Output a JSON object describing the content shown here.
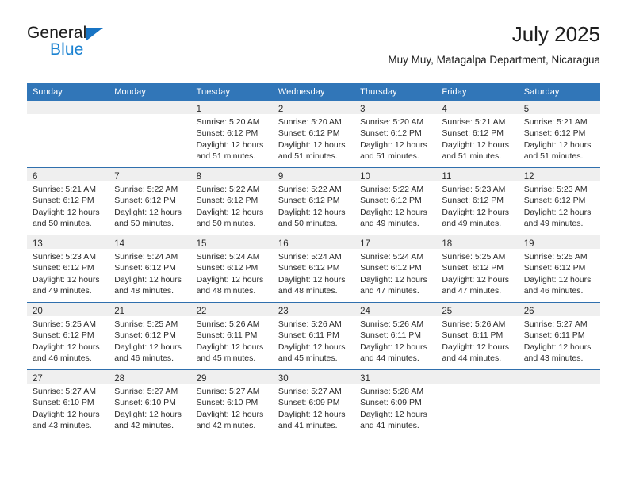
{
  "brand": {
    "name_top": "General",
    "name_bottom": "Blue",
    "triangle_icon": "brand-triangle-icon",
    "accent_color": "#1b82d1"
  },
  "header": {
    "title": "July 2025",
    "subtitle": "Muy Muy, Matagalpa Department, Nicaragua"
  },
  "theme": {
    "header_blue": "#3176b8",
    "row_separator": "#2f6fad",
    "daynum_band": "#efefef"
  },
  "weekday_headers": [
    "Sunday",
    "Monday",
    "Tuesday",
    "Wednesday",
    "Thursday",
    "Friday",
    "Saturday"
  ],
  "weeks": [
    [
      {
        "day": "",
        "lines": []
      },
      {
        "day": "",
        "lines": []
      },
      {
        "day": "1",
        "lines": [
          "Sunrise: 5:20 AM",
          "Sunset: 6:12 PM",
          "Daylight: 12 hours",
          "and 51 minutes."
        ]
      },
      {
        "day": "2",
        "lines": [
          "Sunrise: 5:20 AM",
          "Sunset: 6:12 PM",
          "Daylight: 12 hours",
          "and 51 minutes."
        ]
      },
      {
        "day": "3",
        "lines": [
          "Sunrise: 5:20 AM",
          "Sunset: 6:12 PM",
          "Daylight: 12 hours",
          "and 51 minutes."
        ]
      },
      {
        "day": "4",
        "lines": [
          "Sunrise: 5:21 AM",
          "Sunset: 6:12 PM",
          "Daylight: 12 hours",
          "and 51 minutes."
        ]
      },
      {
        "day": "5",
        "lines": [
          "Sunrise: 5:21 AM",
          "Sunset: 6:12 PM",
          "Daylight: 12 hours",
          "and 51 minutes."
        ]
      }
    ],
    [
      {
        "day": "6",
        "lines": [
          "Sunrise: 5:21 AM",
          "Sunset: 6:12 PM",
          "Daylight: 12 hours",
          "and 50 minutes."
        ]
      },
      {
        "day": "7",
        "lines": [
          "Sunrise: 5:22 AM",
          "Sunset: 6:12 PM",
          "Daylight: 12 hours",
          "and 50 minutes."
        ]
      },
      {
        "day": "8",
        "lines": [
          "Sunrise: 5:22 AM",
          "Sunset: 6:12 PM",
          "Daylight: 12 hours",
          "and 50 minutes."
        ]
      },
      {
        "day": "9",
        "lines": [
          "Sunrise: 5:22 AM",
          "Sunset: 6:12 PM",
          "Daylight: 12 hours",
          "and 50 minutes."
        ]
      },
      {
        "day": "10",
        "lines": [
          "Sunrise: 5:22 AM",
          "Sunset: 6:12 PM",
          "Daylight: 12 hours",
          "and 49 minutes."
        ]
      },
      {
        "day": "11",
        "lines": [
          "Sunrise: 5:23 AM",
          "Sunset: 6:12 PM",
          "Daylight: 12 hours",
          "and 49 minutes."
        ]
      },
      {
        "day": "12",
        "lines": [
          "Sunrise: 5:23 AM",
          "Sunset: 6:12 PM",
          "Daylight: 12 hours",
          "and 49 minutes."
        ]
      }
    ],
    [
      {
        "day": "13",
        "lines": [
          "Sunrise: 5:23 AM",
          "Sunset: 6:12 PM",
          "Daylight: 12 hours",
          "and 49 minutes."
        ]
      },
      {
        "day": "14",
        "lines": [
          "Sunrise: 5:24 AM",
          "Sunset: 6:12 PM",
          "Daylight: 12 hours",
          "and 48 minutes."
        ]
      },
      {
        "day": "15",
        "lines": [
          "Sunrise: 5:24 AM",
          "Sunset: 6:12 PM",
          "Daylight: 12 hours",
          "and 48 minutes."
        ]
      },
      {
        "day": "16",
        "lines": [
          "Sunrise: 5:24 AM",
          "Sunset: 6:12 PM",
          "Daylight: 12 hours",
          "and 48 minutes."
        ]
      },
      {
        "day": "17",
        "lines": [
          "Sunrise: 5:24 AM",
          "Sunset: 6:12 PM",
          "Daylight: 12 hours",
          "and 47 minutes."
        ]
      },
      {
        "day": "18",
        "lines": [
          "Sunrise: 5:25 AM",
          "Sunset: 6:12 PM",
          "Daylight: 12 hours",
          "and 47 minutes."
        ]
      },
      {
        "day": "19",
        "lines": [
          "Sunrise: 5:25 AM",
          "Sunset: 6:12 PM",
          "Daylight: 12 hours",
          "and 46 minutes."
        ]
      }
    ],
    [
      {
        "day": "20",
        "lines": [
          "Sunrise: 5:25 AM",
          "Sunset: 6:12 PM",
          "Daylight: 12 hours",
          "and 46 minutes."
        ]
      },
      {
        "day": "21",
        "lines": [
          "Sunrise: 5:25 AM",
          "Sunset: 6:12 PM",
          "Daylight: 12 hours",
          "and 46 minutes."
        ]
      },
      {
        "day": "22",
        "lines": [
          "Sunrise: 5:26 AM",
          "Sunset: 6:11 PM",
          "Daylight: 12 hours",
          "and 45 minutes."
        ]
      },
      {
        "day": "23",
        "lines": [
          "Sunrise: 5:26 AM",
          "Sunset: 6:11 PM",
          "Daylight: 12 hours",
          "and 45 minutes."
        ]
      },
      {
        "day": "24",
        "lines": [
          "Sunrise: 5:26 AM",
          "Sunset: 6:11 PM",
          "Daylight: 12 hours",
          "and 44 minutes."
        ]
      },
      {
        "day": "25",
        "lines": [
          "Sunrise: 5:26 AM",
          "Sunset: 6:11 PM",
          "Daylight: 12 hours",
          "and 44 minutes."
        ]
      },
      {
        "day": "26",
        "lines": [
          "Sunrise: 5:27 AM",
          "Sunset: 6:11 PM",
          "Daylight: 12 hours",
          "and 43 minutes."
        ]
      }
    ],
    [
      {
        "day": "27",
        "lines": [
          "Sunrise: 5:27 AM",
          "Sunset: 6:10 PM",
          "Daylight: 12 hours",
          "and 43 minutes."
        ]
      },
      {
        "day": "28",
        "lines": [
          "Sunrise: 5:27 AM",
          "Sunset: 6:10 PM",
          "Daylight: 12 hours",
          "and 42 minutes."
        ]
      },
      {
        "day": "29",
        "lines": [
          "Sunrise: 5:27 AM",
          "Sunset: 6:10 PM",
          "Daylight: 12 hours",
          "and 42 minutes."
        ]
      },
      {
        "day": "30",
        "lines": [
          "Sunrise: 5:27 AM",
          "Sunset: 6:09 PM",
          "Daylight: 12 hours",
          "and 41 minutes."
        ]
      },
      {
        "day": "31",
        "lines": [
          "Sunrise: 5:28 AM",
          "Sunset: 6:09 PM",
          "Daylight: 12 hours",
          "and 41 minutes."
        ]
      },
      {
        "day": "",
        "lines": []
      },
      {
        "day": "",
        "lines": []
      }
    ]
  ]
}
